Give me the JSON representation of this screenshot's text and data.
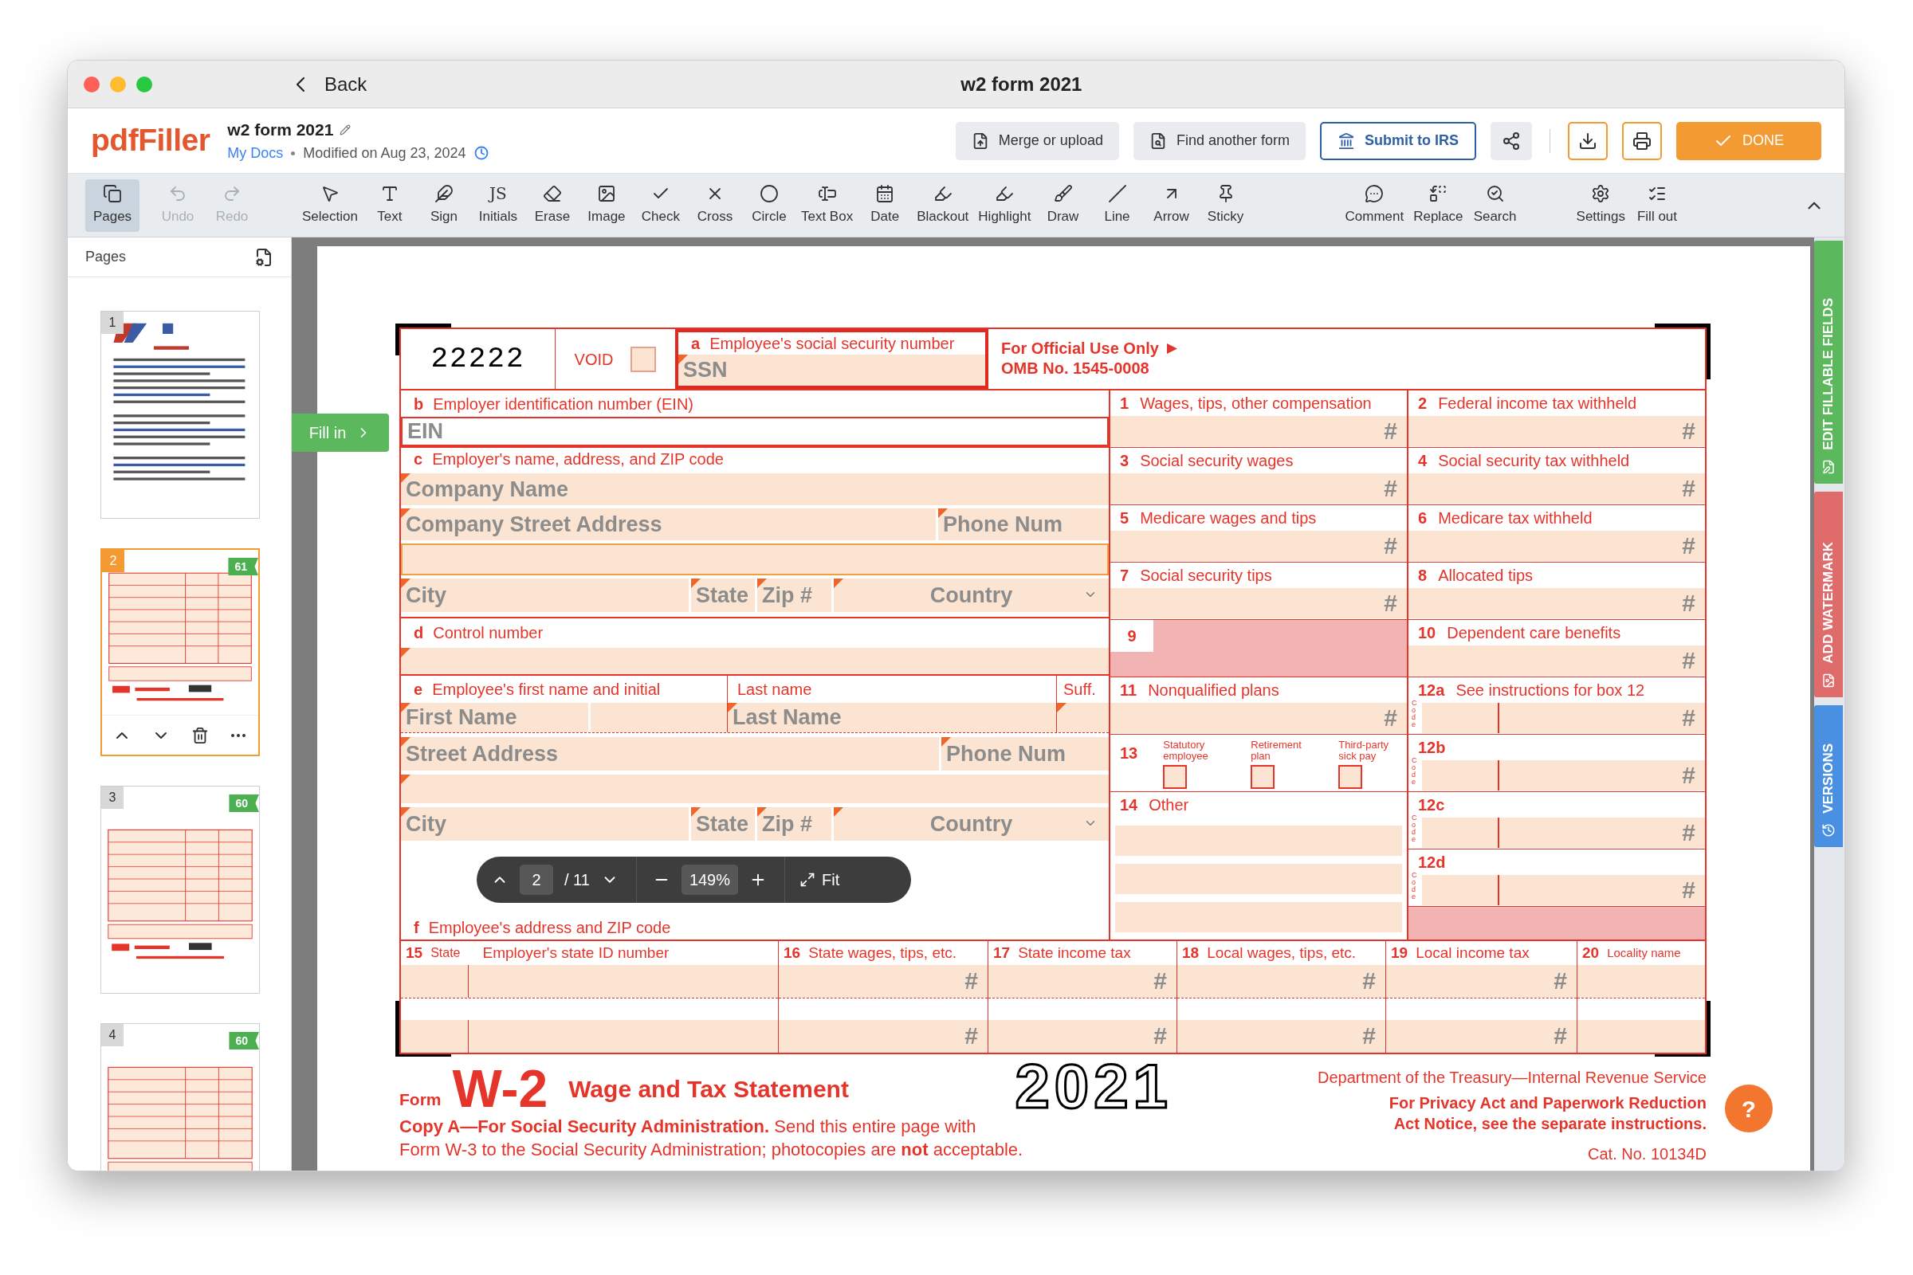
{
  "window": {
    "title": "w2 form 2021",
    "back": "Back"
  },
  "header": {
    "logo": "pdfFiller",
    "doc_title": "w2 form 2021",
    "location": "My Docs",
    "modified": "Modified on Aug 23, 2024",
    "actions": [
      {
        "label": "Merge or upload",
        "kind": "merge"
      },
      {
        "label": "Find another form",
        "kind": "find"
      },
      {
        "label": "Submit to IRS",
        "kind": "irs"
      }
    ],
    "done": "DONE"
  },
  "toolbar": {
    "groups": [
      [
        {
          "label": "Pages",
          "kind": "pages",
          "selected": true,
          "disabled": false
        },
        {
          "label": "Undo",
          "kind": "undo",
          "selected": false,
          "disabled": true
        },
        {
          "label": "Redo",
          "kind": "redo",
          "selected": false,
          "disabled": true
        }
      ],
      [
        {
          "label": "Selection",
          "kind": "selection",
          "selected": false,
          "disabled": false
        },
        {
          "label": "Text",
          "kind": "text",
          "selected": false,
          "disabled": false
        },
        {
          "label": "Sign",
          "kind": "sign",
          "selected": false,
          "disabled": false
        },
        {
          "label": "Initials",
          "kind": "initials",
          "glyph": "JS",
          "selected": false,
          "disabled": false
        },
        {
          "label": "Erase",
          "kind": "erase",
          "selected": false,
          "disabled": false
        },
        {
          "label": "Image",
          "kind": "image",
          "selected": false,
          "disabled": false
        },
        {
          "label": "Check",
          "kind": "check",
          "selected": false,
          "disabled": false
        },
        {
          "label": "Cross",
          "kind": "cross",
          "selected": false,
          "disabled": false
        },
        {
          "label": "Circle",
          "kind": "circle",
          "selected": false,
          "disabled": false
        },
        {
          "label": "Text Box",
          "kind": "textbox",
          "selected": false,
          "disabled": false
        },
        {
          "label": "Date",
          "kind": "date",
          "selected": false,
          "disabled": false
        },
        {
          "label": "Blackout",
          "kind": "blackout",
          "selected": false,
          "disabled": false
        },
        {
          "label": "Highlight",
          "kind": "highlight",
          "selected": false,
          "disabled": false
        },
        {
          "label": "Draw",
          "kind": "draw",
          "selected": false,
          "disabled": false
        },
        {
          "label": "Line",
          "kind": "line",
          "selected": false,
          "disabled": false
        },
        {
          "label": "Arrow",
          "kind": "arrow",
          "selected": false,
          "disabled": false
        },
        {
          "label": "Sticky",
          "kind": "sticky",
          "selected": false,
          "disabled": false
        }
      ],
      [
        {
          "label": "Comment",
          "kind": "comment",
          "selected": false,
          "disabled": false
        },
        {
          "label": "Replace",
          "kind": "replace",
          "selected": false,
          "disabled": false
        },
        {
          "label": "Search",
          "kind": "search",
          "selected": false,
          "disabled": false
        }
      ],
      [
        {
          "label": "Settings",
          "kind": "settings",
          "selected": false,
          "disabled": false
        },
        {
          "label": "Fill out",
          "kind": "fillout",
          "selected": false,
          "disabled": false
        }
      ]
    ]
  },
  "sidebar": {
    "title": "Pages",
    "pages": [
      {
        "number": "1",
        "selected": false
      },
      {
        "number": "2",
        "selected": true,
        "badge": "61"
      },
      {
        "number": "3",
        "selected": false,
        "badge": "60"
      },
      {
        "number": "4",
        "selected": false,
        "badge": "60"
      }
    ]
  },
  "fill_in": "Fill in",
  "side_tabs": [
    {
      "label": "EDIT FILLABLE FIELDS",
      "color": "#5cb85c"
    },
    {
      "label": "ADD WATERMARK",
      "color": "#e06b6b"
    },
    {
      "label": "VERSIONS",
      "color": "#4a90e2"
    }
  ],
  "form": {
    "code": "22222",
    "void": {
      "label": "VOID",
      "checked": false
    },
    "ssn": {
      "letter": "a",
      "label": "Employee's social security number",
      "placeholder": "SSN"
    },
    "official": {
      "line1": "For Official Use Only",
      "line2": "OMB No. 1545-0008"
    },
    "ein": {
      "letter": "b",
      "label": "Employer identification number (EIN)",
      "placeholder": "EIN"
    },
    "employer": {
      "letter": "c",
      "label": "Employer's name, address, and ZIP code",
      "name": {
        "placeholder": "Company Name"
      },
      "street": {
        "placeholder": "Company Street Address"
      },
      "phone": {
        "placeholder": "Phone Num"
      },
      "city": {
        "placeholder": "City"
      },
      "state": {
        "placeholder": "State"
      },
      "zip": {
        "placeholder": "Zip #"
      },
      "country": {
        "placeholder": "Country"
      }
    },
    "control": {
      "letter": "d",
      "label": "Control number"
    },
    "employee": {
      "letter": "e",
      "first_label": "Employee's first name and initial",
      "last_label": "Last name",
      "suffix_label": "Suff.",
      "first": {
        "placeholder": "First Name"
      },
      "last": {
        "placeholder": "Last Name"
      },
      "street": {
        "placeholder": "Street Address"
      },
      "phone": {
        "placeholder": "Phone Num"
      },
      "city": {
        "placeholder": "City"
      },
      "state": {
        "placeholder": "State"
      },
      "zip": {
        "placeholder": "Zip #"
      },
      "country": {
        "placeholder": "Country"
      }
    },
    "address": {
      "letter": "f",
      "label": "Employee's address and ZIP code"
    },
    "boxes_left": [
      {
        "kind": "amount",
        "number": "1",
        "label": "Wages, tips, other compensation",
        "placeholder": "#"
      },
      {
        "kind": "amount",
        "number": "3",
        "label": "Social security wages",
        "placeholder": "#"
      },
      {
        "kind": "amount",
        "number": "5",
        "label": "Medicare wages and tips",
        "placeholder": "#"
      },
      {
        "kind": "amount",
        "number": "7",
        "label": "Social security tips",
        "placeholder": "#"
      },
      {
        "kind": "shaded",
        "number": "9"
      },
      {
        "kind": "amount",
        "number": "11",
        "label": "Nonqualified plans",
        "placeholder": "#"
      },
      {
        "kind": "checks",
        "number": "13",
        "options": [
          {
            "label": "Statutory employee",
            "checked": false
          },
          {
            "label": "Retirement plan",
            "checked": false
          },
          {
            "label": "Third-party sick pay",
            "checked": false
          }
        ]
      },
      {
        "kind": "other",
        "number": "14",
        "label": "Other"
      }
    ],
    "boxes_right": [
      {
        "kind": "amount",
        "number": "2",
        "label": "Federal income tax withheld",
        "placeholder": "#"
      },
      {
        "kind": "amount",
        "number": "4",
        "label": "Social security tax withheld",
        "placeholder": "#"
      },
      {
        "kind": "amount",
        "number": "6",
        "label": "Medicare tax withheld",
        "placeholder": "#"
      },
      {
        "kind": "amount",
        "number": "8",
        "label": "Allocated tips",
        "placeholder": "#"
      },
      {
        "kind": "amount",
        "number": "10",
        "label": "Dependent care benefits",
        "placeholder": "#"
      },
      {
        "kind": "code",
        "number": "12a",
        "label": "See instructions for box 12",
        "code": "Code",
        "placeholder": "#"
      },
      {
        "kind": "code",
        "number": "12b",
        "code": "Code",
        "placeholder": "#"
      },
      {
        "kind": "code",
        "number": "12c",
        "code": "Code",
        "placeholder": "#"
      },
      {
        "kind": "code",
        "number": "12d",
        "code": "Code",
        "placeholder": "#"
      }
    ],
    "state_row": [
      {
        "kind": "state",
        "number": "15",
        "label": "State",
        "extra": "Employer's state ID number"
      },
      {
        "kind": "amount",
        "number": "16",
        "label": "State wages, tips, etc.",
        "placeholders": [
          "#",
          "#"
        ]
      },
      {
        "kind": "amount",
        "number": "17",
        "label": "State income tax",
        "placeholders": [
          "#",
          "#"
        ]
      },
      {
        "kind": "amount",
        "number": "18",
        "label": "Local wages, tips, etc.",
        "placeholders": [
          "#",
          "#"
        ]
      },
      {
        "kind": "amount",
        "number": "19",
        "label": "Local income tax",
        "placeholders": [
          "#",
          "#"
        ]
      },
      {
        "kind": "text",
        "number": "20",
        "label": "Locality name"
      }
    ],
    "footer": {
      "form_word": "Form",
      "form_name": "W-2",
      "title": "Wage and Tax Statement",
      "year": "2021",
      "copy_lines": [
        "**Copy A—For Social Security Administration.** Send this entire page with",
        "Form W-3 to the Social Security Administration; photocopies are **not** acceptable."
      ],
      "department": "Department of the Treasury—Internal Revenue Service",
      "privacy_lines": [
        "For Privacy Act and Paperwork Reduction",
        "Act Notice, see the separate instructions."
      ],
      "cat": "Cat. No. 10134D"
    }
  },
  "page_nav": {
    "page": "2",
    "total": "/ 11",
    "zoom": "149%",
    "fit": "Fit"
  },
  "help": "?"
}
